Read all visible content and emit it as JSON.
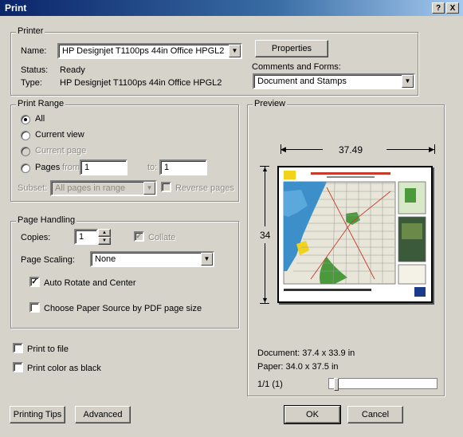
{
  "window": {
    "title": "Print",
    "help_label": "?",
    "close_label": "X"
  },
  "printer": {
    "legend": "Printer",
    "name_label": "Name:",
    "name_value": "HP Designjet T1100ps 44in Office HPGL2",
    "status_label": "Status:",
    "status_value": "Ready",
    "type_label": "Type:",
    "type_value": "HP Designjet T1100ps 44in Office HPGL2",
    "properties_label": "Properties",
    "comments_label": "Comments and Forms:",
    "comments_value": "Document and Stamps"
  },
  "print_range": {
    "legend": "Print Range",
    "all_label": "All",
    "current_view_label": "Current view",
    "current_page_label": "Current page",
    "pages_label": "Pages",
    "from_label": "from:",
    "from_value": "1",
    "to_label": "to:",
    "to_value": "1",
    "subset_label": "Subset:",
    "subset_value": "All pages in range",
    "reverse_label": "Reverse pages"
  },
  "page_handling": {
    "legend": "Page Handling",
    "copies_label": "Copies:",
    "copies_value": "1",
    "collate_label": "Collate",
    "scaling_label": "Page Scaling:",
    "scaling_value": "None",
    "auto_rotate_label": "Auto Rotate and Center",
    "paper_source_label": "Choose Paper Source by PDF page size"
  },
  "options": {
    "print_to_file_label": "Print to file",
    "print_black_label": "Print color as black"
  },
  "preview": {
    "legend": "Preview",
    "width_value": "37.49",
    "height_value": "34",
    "document_size": "Document: 37.4 x 33.9 in",
    "paper_size": "Paper: 34.0 x 37.5 in",
    "page_counter": "1/1 (1)",
    "slider_position": 0.05
  },
  "buttons": {
    "printing_tips": "Printing Tips",
    "advanced": "Advanced",
    "ok": "OK",
    "cancel": "Cancel"
  },
  "colors": {
    "title_bar": "#0a246a",
    "dialog_bg": "#d6d3cb",
    "map_water": "#3d8fc9",
    "map_land": "#e8e6d8",
    "map_green": "#4a9a3c",
    "banner_yellow": "#f2d21a"
  }
}
